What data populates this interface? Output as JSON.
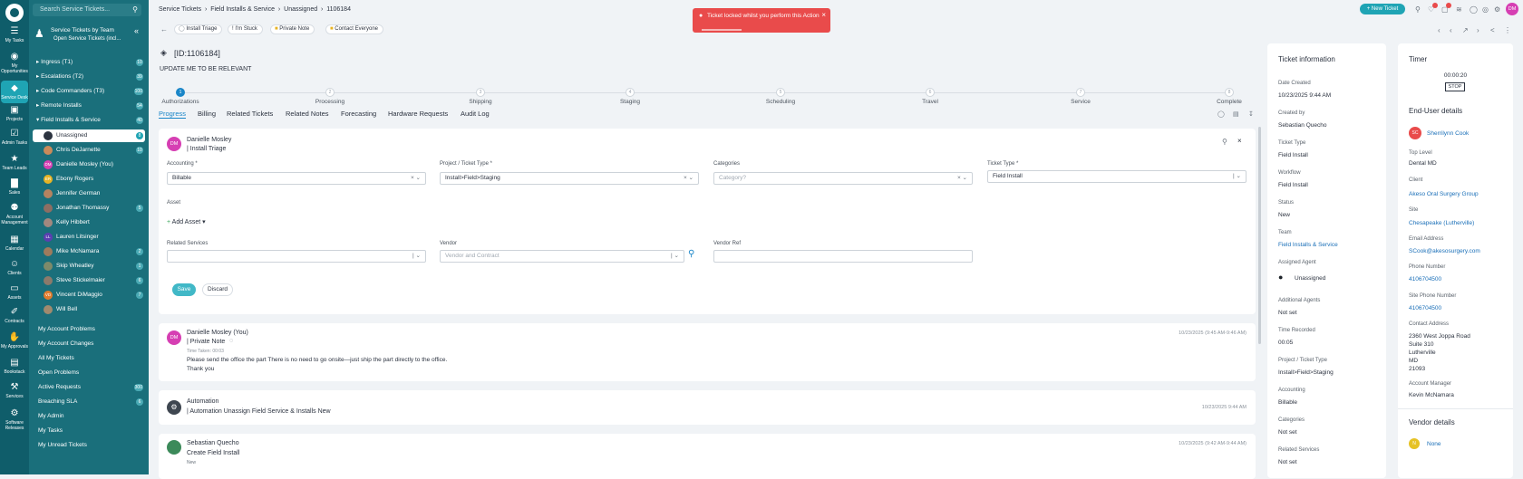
{
  "rail": {
    "items": [
      {
        "label": "My Tasks",
        "icon": "tasks-icon",
        "glyph": "☰"
      },
      {
        "label": "My Opportunities",
        "icon": "eye-icon",
        "glyph": "◉"
      },
      {
        "label": "Service Desk",
        "icon": "service-desk-icon",
        "glyph": "◆"
      },
      {
        "label": "Projects",
        "icon": "projects-icon",
        "glyph": "▣"
      },
      {
        "label": "Admin Tasks",
        "icon": "admin-tasks-icon",
        "glyph": "☑"
      },
      {
        "label": "Team Leads",
        "icon": "star-icon",
        "glyph": "★"
      },
      {
        "label": "Sales",
        "icon": "sales-chart-icon",
        "glyph": "▇"
      },
      {
        "label": "Account Management",
        "icon": "accounts-icon",
        "glyph": "⚉"
      },
      {
        "label": "Calendar",
        "icon": "calendar-icon",
        "glyph": "▦"
      },
      {
        "label": "Clients",
        "icon": "clients-icon",
        "glyph": "☺"
      },
      {
        "label": "Assets",
        "icon": "assets-icon",
        "glyph": "▭"
      },
      {
        "label": "Contracts",
        "icon": "contracts-icon",
        "glyph": "✐"
      },
      {
        "label": "My Approvals",
        "icon": "approvals-icon",
        "glyph": "✋"
      },
      {
        "label": "Bookstack",
        "icon": "bookstack-icon",
        "glyph": "▤"
      },
      {
        "label": "Services",
        "icon": "services-icon",
        "glyph": "⚒"
      },
      {
        "label": "Software Releases",
        "icon": "software-icon",
        "glyph": "⚙"
      }
    ]
  },
  "panel": {
    "search_placeholder": "Search Service Tickets...",
    "team_title": "Service Tickets by Team",
    "team_subtitle": "Open Service Tickets (incl...",
    "groups": [
      {
        "label": "Ingress (T1)",
        "count": "10"
      },
      {
        "label": "Escalations (T2)",
        "count": "39"
      },
      {
        "label": "Code Commanders (T3)",
        "count": "100"
      },
      {
        "label": "Remote Installs",
        "count": "54"
      },
      {
        "label": "Field Installs & Service",
        "count": "40"
      }
    ],
    "members": [
      {
        "label": "Unassigned",
        "count": "8",
        "initials": "",
        "color": "#2c3340"
      },
      {
        "label": "Chris DeJarnette",
        "count": "10",
        "initials": "",
        "color": "#c98a5a"
      },
      {
        "label": "Danielle Mosley (You)",
        "count": "",
        "initials": "DM",
        "color": "#d63fb3"
      },
      {
        "label": "Ebony Rogers",
        "count": "",
        "initials": "ER",
        "color": "#e6b325"
      },
      {
        "label": "Jennifer German",
        "count": "",
        "initials": "",
        "color": "#b58360"
      },
      {
        "label": "Jonathan Thomassy",
        "count": "5",
        "initials": "",
        "color": "#8d6e63"
      },
      {
        "label": "Kelly Hibbert",
        "count": "",
        "initials": "",
        "color": "#a1887f"
      },
      {
        "label": "Lauren Litsinger",
        "count": "",
        "initials": "LL",
        "color": "#5a3fb0"
      },
      {
        "label": "Mike McNamara",
        "count": "2",
        "initials": "",
        "color": "#9e7b5d"
      },
      {
        "label": "Skip Wheatley",
        "count": "1",
        "initials": "",
        "color": "#7d8a6a"
      },
      {
        "label": "Steve Stickelmaier",
        "count": "6",
        "initials": "",
        "color": "#8c7a6b"
      },
      {
        "label": "Vincent DiMaggio",
        "count": "7",
        "initials": "VD",
        "color": "#e07b2c"
      },
      {
        "label": "Will Bell",
        "count": "",
        "initials": "",
        "color": "#a08a6e"
      }
    ],
    "links": [
      {
        "label": "My Account Problems",
        "count": ""
      },
      {
        "label": "My Account Changes",
        "count": ""
      },
      {
        "label": "All My Tickets",
        "count": ""
      },
      {
        "label": "Open Problems",
        "count": ""
      },
      {
        "label": "Active Requests",
        "count": "300"
      },
      {
        "label": "Breaching SLA",
        "count": "6"
      },
      {
        "label": "My Admin",
        "count": ""
      },
      {
        "label": "My Tasks",
        "count": ""
      },
      {
        "label": "My Unread Tickets",
        "count": ""
      }
    ]
  },
  "breadcrumb": [
    "Service Tickets",
    "Field Installs & Service",
    "Unassigned",
    "1106184"
  ],
  "toolbar": {
    "buttons": [
      "Install Triage",
      "I'm Stuck",
      "Private Note",
      "Contact Everyone"
    ],
    "new_ticket": "+ New Ticket",
    "avatar": "DM"
  },
  "toast": {
    "message": "Ticket locked whilst you perform this Action"
  },
  "ticket": {
    "id": "[ID:1106184]",
    "title": "UPDATE ME TO BE RELEVANT"
  },
  "steps": [
    {
      "n": "1",
      "label": "Authorizations"
    },
    {
      "n": "2",
      "label": "Processing"
    },
    {
      "n": "3",
      "label": "Shipping"
    },
    {
      "n": "4",
      "label": "Staging"
    },
    {
      "n": "5",
      "label": "Scheduling"
    },
    {
      "n": "6",
      "label": "Travel"
    },
    {
      "n": "7",
      "label": "Service"
    },
    {
      "n": "8",
      "label": "Complete"
    }
  ],
  "tabs": [
    "Progress",
    "Billing",
    "Related Tickets",
    "Related Notes",
    "Forecasting",
    "Hardware Requests",
    "Audit Log"
  ],
  "form": {
    "author": "Danielle Mosley",
    "author_initials": "DM",
    "action": "| Install Triage",
    "accounting_label": "Accounting *",
    "accounting_value": "Billable",
    "project_label": "Project / Ticket Type *",
    "project_value": "Install>Field>Staging",
    "categories_label": "Categories",
    "categories_placeholder": "Category?",
    "ticket_type_label": "Ticket Type *",
    "ticket_type_value": "Field Install",
    "asset_label": "Asset",
    "add_asset": "Add Asset",
    "related_services_label": "Related Services",
    "vendor_label": "Vendor",
    "vendor_placeholder": "Vendor and Contract",
    "vendor_ref_label": "Vendor Ref",
    "save": "Save",
    "discard": "Discard"
  },
  "notes": [
    {
      "author": "Danielle Mosley (You)",
      "initials": "DM",
      "kind": "| Private Note",
      "time_taken": "Time Taken: 00:03",
      "body1": "Please send the office the part There is no need to go onsite—just ship the part directly to the office.",
      "body2": "Thank you",
      "date": "10/23/2025 (9:45 AM-9:46 AM)"
    },
    {
      "author": "Automation",
      "kind": "| Automation Unassign Field Service & Installs New",
      "date": "10/23/2025 9:44 AM"
    },
    {
      "author": "Sebastian Quecho",
      "kind": "Create Field Install",
      "badge": "New",
      "date": "10/23/2025 (9:42 AM-9:44 AM)"
    }
  ],
  "ticket_info": {
    "title": "Ticket information",
    "fields": [
      {
        "label": "Date Created",
        "value": "10/23/2025 9:44 AM"
      },
      {
        "label": "Created by",
        "value": "Sebastian Quecho"
      },
      {
        "label": "Ticket Type",
        "value": "Field Install"
      },
      {
        "label": "Workflow",
        "value": "Field Install"
      },
      {
        "label": "Status",
        "value": "New"
      },
      {
        "label": "Team",
        "value": "Field Installs & Service"
      },
      {
        "label": "Assigned Agent",
        "value": "Unassigned"
      },
      {
        "label": "Additional Agents",
        "value": "Not set"
      },
      {
        "label": "Time Recorded",
        "value": "00:05"
      },
      {
        "label": "Project / Ticket Type",
        "value": "Install>Field>Staging"
      },
      {
        "label": "Accounting",
        "value": "Billable"
      },
      {
        "label": "Categories",
        "value": "Not set"
      },
      {
        "label": "Related Services",
        "value": "Not set"
      }
    ]
  },
  "timer": {
    "title": "Timer",
    "value": "00:00:20",
    "stop": "STOP"
  },
  "end_user": {
    "title": "End-User details",
    "name": "Sherrilynn Cook",
    "initials": "SC",
    "top_level_label": "Top Level",
    "top_level": "Dental MD",
    "client_label": "Client",
    "client": "Akeso Oral Surgery Group",
    "site_label": "Site",
    "site": "Chesapeake (Lutherville)",
    "email_label": "Email Address",
    "email": "SCook@akesosurgery.com",
    "phone_label": "Phone Number",
    "phone": "4106704500",
    "site_phone_label": "Site Phone Number",
    "site_phone": "4106704500",
    "address_label": "Contact Address",
    "address": [
      "2360 West Joppa Road",
      "Suite 310",
      "Lutherville",
      "MD",
      "21093"
    ],
    "manager_label": "Account Manager",
    "manager": "Kevin McNamara"
  },
  "vendor": {
    "title": "Vendor details",
    "name": "None"
  }
}
